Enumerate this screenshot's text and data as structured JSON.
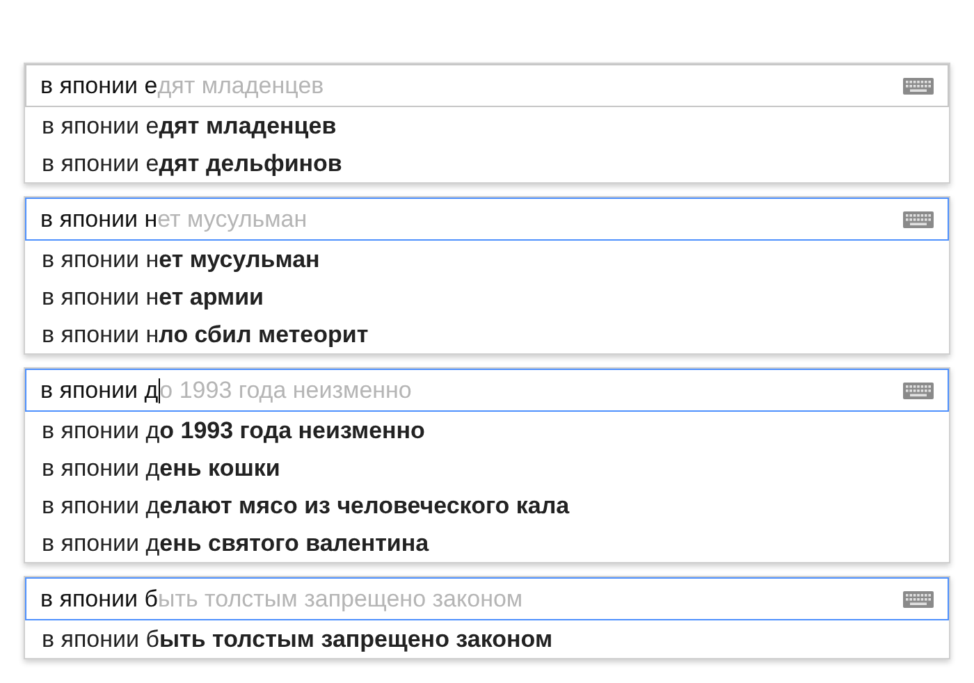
{
  "blocks": [
    {
      "field": {
        "value": "в японии е",
        "completion": "дят младенцев",
        "focused": false,
        "cursor": false
      },
      "suggestions": [
        "в японии е**дят младенцев**",
        "в японии е**дят дельфинов**"
      ]
    },
    {
      "field": {
        "value": "в японии н",
        "completion": "ет мусульман",
        "focused": true,
        "cursor": false
      },
      "suggestions": [
        "в японии н**ет мусульман**",
        "в японии н**ет армии**",
        "в японии н**ло сбил метеорит**"
      ]
    },
    {
      "field": {
        "value": "в японии д",
        "completion": "о 1993 года неизменно",
        "focused": true,
        "cursor": true
      },
      "suggestions": [
        "в японии д**о 1993 года неизменно**",
        "в японии д**ень кошки**",
        "в японии д**елают мясо из человеческого кала**",
        "в японии д**ень святого валентина**"
      ]
    },
    {
      "field": {
        "value": "в японии б",
        "completion": "ыть толстым запрещено законом",
        "focused": true,
        "cursor": false
      },
      "suggestions": [
        "в японии б**ыть толстым запрещено законом**"
      ]
    }
  ]
}
